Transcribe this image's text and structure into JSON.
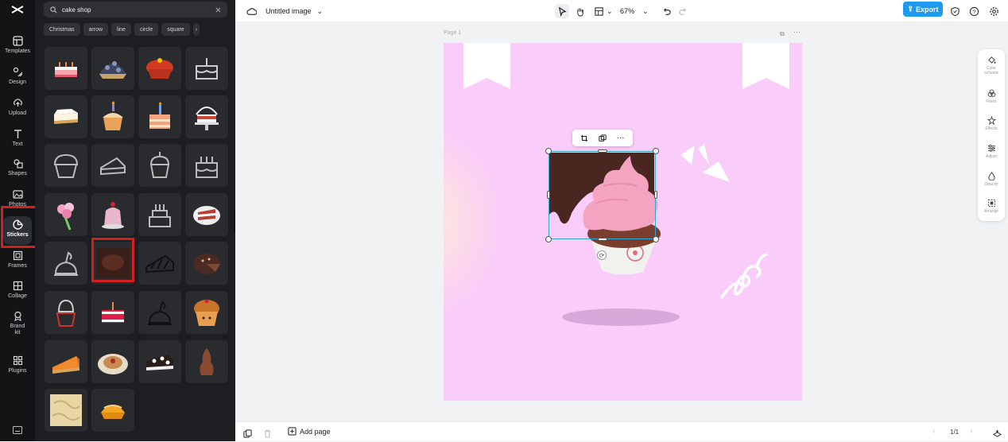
{
  "rail": {
    "items": [
      {
        "label": "Templates",
        "icon": "templates-icon"
      },
      {
        "label": "Design",
        "icon": "design-icon"
      },
      {
        "label": "Upload",
        "icon": "upload-icon"
      },
      {
        "label": "Text",
        "icon": "text-icon"
      },
      {
        "label": "Shapes",
        "icon": "shapes-icon"
      },
      {
        "label": "Photos",
        "icon": "photos-icon"
      },
      {
        "label": "Stickers",
        "icon": "stickers-icon"
      },
      {
        "label": "Frames",
        "icon": "frames-icon"
      },
      {
        "label": "Collage",
        "icon": "collage-icon"
      },
      {
        "label": "Brand kit",
        "icon": "brand-kit-icon"
      },
      {
        "label": "Plugins",
        "icon": "plugins-icon"
      }
    ],
    "active": "Stickers"
  },
  "search": {
    "value": "cake shop"
  },
  "chips": [
    "Christmas",
    "arrow",
    "line",
    "circle",
    "square"
  ],
  "topbar": {
    "title": "Untitled image",
    "zoom": "67%",
    "export_label": "Export"
  },
  "canvas": {
    "page_label": "Page 1"
  },
  "sidepanel": {
    "items": [
      "Color scheme",
      "Filters",
      "Effects",
      "Adjust",
      "Opacity",
      "Arrange"
    ]
  },
  "bottombar": {
    "add_page": "Add page",
    "page_counter": "1/1"
  },
  "colors": {
    "accent": "#1c9bf0",
    "canvas_bg": "#f9ccfa",
    "highlight": "#d21f1f"
  }
}
